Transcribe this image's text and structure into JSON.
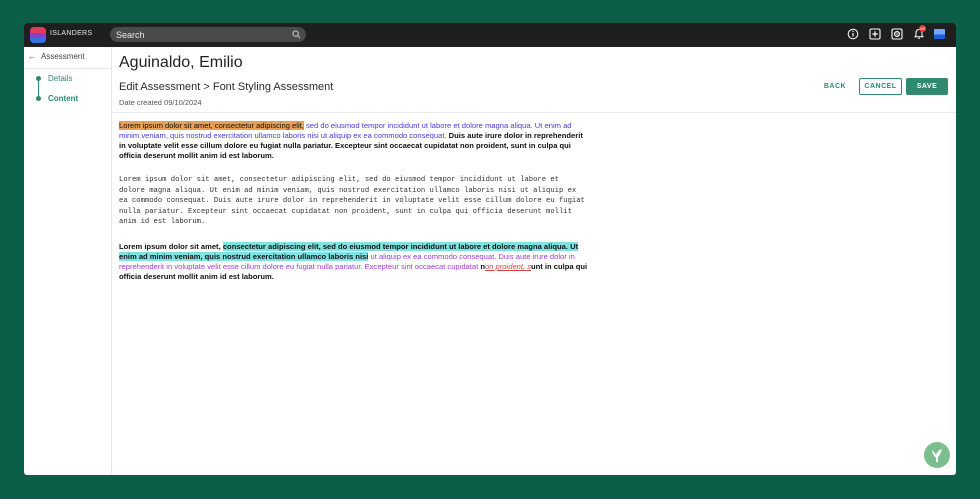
{
  "topbar": {
    "brand": "ISLANDERS",
    "search_placeholder": "Search",
    "icons": [
      "info-icon",
      "add-box-icon",
      "settings-box-icon",
      "notifications-icon",
      "flag-icon"
    ],
    "notification_count": "99"
  },
  "sidebar": {
    "back_label": "Assessment",
    "steps": [
      {
        "label": "Details",
        "active": false
      },
      {
        "label": "Content",
        "active": true
      }
    ]
  },
  "header": {
    "student_name": "Aguinaldo, Emilio",
    "breadcrumb": "Edit Assessment > Font Styling Assessment",
    "date_created": "Date created 09/10/2024",
    "back_label": "BACK",
    "cancel_label": "CANCEL",
    "save_label": "SAVE"
  },
  "editor": {
    "p1": {
      "hl": "Lorem ipsum dolor sit amet, consectetur adipiscing elit,",
      "blue": "sed do eiusmod tempor incididunt ut labore et dolore magna aliqua. Ut enim ad minim veniam, quis nostrud exercitation ullamco laboris nisi ut aliquip ex ea commodo consequat.",
      "bold": "Duis aute irure dolor in reprehenderit in voluptate velit esse cillum dolore eu fugiat nulla pariatur. Excepteur sint occaecat cupidatat non proident, sunt in culpa qui officia deserunt mollit anim id est laborum."
    },
    "p2": "Lorem ipsum dolor sit amet, consectetur adipiscing elit, sed do eiusmod tempor incididunt ut labore et dolore magna aliqua. Ut enim ad minim veniam, quis nostrud exercitation ullamco laboris nisi ut aliquip ex ea commodo consequat. Duis aute irure dolor in reprehenderit in voluptate velit esse cillum dolore eu fugiat nulla pariatur. Excepteur sint occaecat cupidatat non proident, sunt in culpa qui officia deserunt mollit anim id est laborum.",
    "p3": {
      "plain1": "Lorem ipsum dolor sit amet,",
      "hl": "consectetur adipiscing elit, sed do eiusmod tempor incididunt ut labore et dolore magna aliqua. Ut enim ad minim veniam, quis nostrud exercitation ullamco laboris nisi",
      "purple": "ut aliquip ex ea commodo consequat. Duis aute irure dolor in reprehenderit in voluptate velit esse cillum dolore eu fugiat nulla pariatur. Excepteur sint occaecat cupidatat",
      "plain2": "n",
      "red": "on proident, s",
      "bold": "unt in culpa qui officia deserunt mollit anim id est laborum."
    }
  },
  "colors": {
    "frame": "#0b5e48",
    "accent": "#2f8a70",
    "highlight_orange": "#e8a052",
    "highlight_cyan": "#7fe3e2",
    "text_blue": "#4b3bd8",
    "text_purple": "#a23ad8"
  }
}
